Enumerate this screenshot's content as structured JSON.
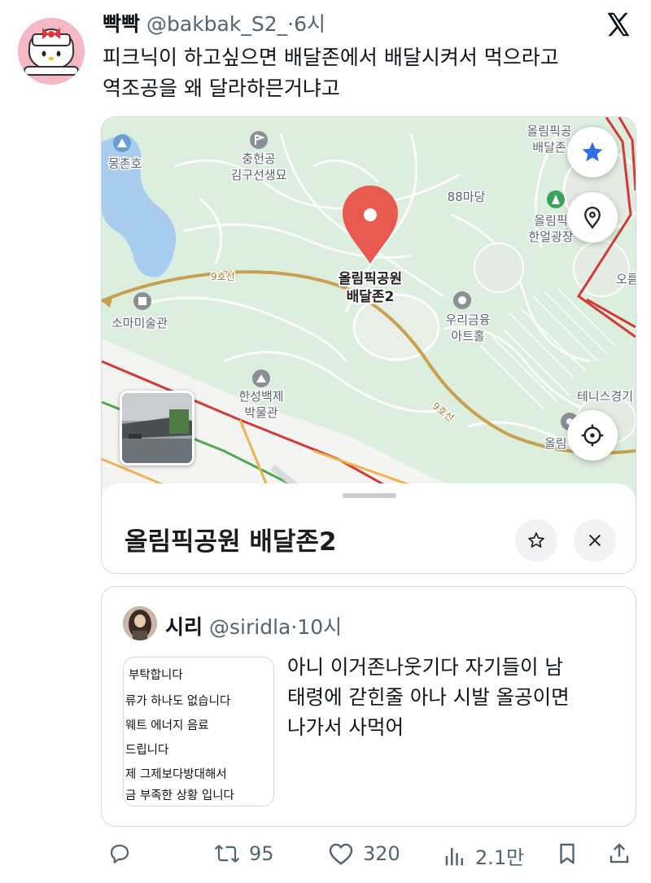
{
  "tweet": {
    "display_name": "빡빡",
    "handle": "@bakbak_S2_",
    "time": "·6시",
    "text_lines": [
      "피크닉이 하고싶으면 배달존에서 배달시켜서 먹으라고",
      "역조공을 왜 달라하믄거냐고"
    ]
  },
  "map": {
    "labels": {
      "lake": "몽촌호",
      "memorial": "충헌공\n김구선생묘",
      "madang": "88마당",
      "olympic_top": "올림픽공\n배달존",
      "olympic_hanul": "올림픽\n한얼광장",
      "line9_a": "9호선",
      "line9_b": "9호선",
      "soma": "소마미술관",
      "woori": "우리금융\n아트홀",
      "hanseong": "한성백제\n박물관",
      "tennis": "테니스경기",
      "olympic_bottom": "올림",
      "olympic_right": "오름",
      "pin_label": "올림픽공원\n배달존2"
    },
    "place_title": "올림픽공원 배달존2",
    "colors": {
      "park": "#dceedd",
      "water": "#a9cdef",
      "pin": "#e85a4f",
      "subway": "#c8a04f",
      "road_red": "#d33a35"
    }
  },
  "quote": {
    "display_name": "시리",
    "handle": "@siridla",
    "time": "·10시",
    "image_lines": [
      "부탁합니다",
      "류가 하나도 없습니다",
      "웨트 에너지  음료",
      "드립니다",
      "제 그제보다방대해서",
      "금 부족한 상황 입니다"
    ],
    "text_lines": [
      "아니 이거존나웃기다 자기들이 남",
      "태령에 갇힌줄 아나 시발 올공이면",
      "나가서 사먹어"
    ]
  },
  "actions": {
    "reply": {
      "icon": "reply-icon",
      "count": ""
    },
    "retweet": {
      "icon": "retweet-icon",
      "count": "95"
    },
    "like": {
      "icon": "heart-icon",
      "count": "320"
    },
    "views": {
      "icon": "views-icon",
      "count": "2.1만"
    },
    "bookmark": {
      "icon": "bookmark-icon"
    },
    "share": {
      "icon": "share-icon"
    }
  }
}
